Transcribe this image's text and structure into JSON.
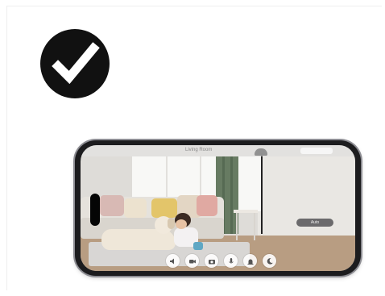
{
  "check_badge": {
    "icon": "check-mark-icon",
    "fill": "#111111",
    "mark_color": "#ffffff"
  },
  "phone": {
    "frame_color": "#1c1c1e",
    "bezel_color": "#8d8d93",
    "camera_view": {
      "status_title": "Living Room",
      "mode_label": "Auto",
      "controls": [
        {
          "name": "speaker-icon"
        },
        {
          "name": "record-video-icon"
        },
        {
          "name": "snapshot-camera-icon"
        },
        {
          "name": "microphone-icon"
        },
        {
          "name": "alarm-siren-icon"
        },
        {
          "name": "night-mode-icon"
        }
      ]
    }
  }
}
